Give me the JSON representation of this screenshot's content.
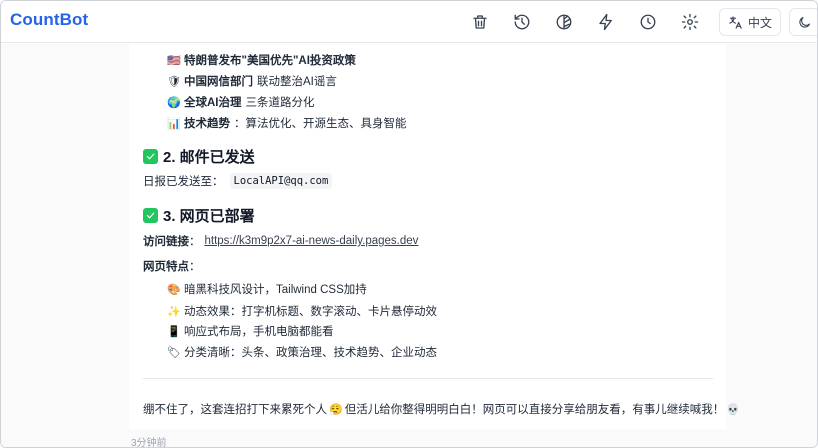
{
  "app": {
    "title": "CountBot"
  },
  "toolbar": {
    "items": [
      {
        "icon": "trash-icon"
      },
      {
        "icon": "history-icon"
      },
      {
        "icon": "contrast-icon"
      },
      {
        "icon": "lightning-icon"
      },
      {
        "icon": "clock-icon"
      },
      {
        "icon": "gear-icon"
      }
    ],
    "language_label": "中文"
  },
  "message": {
    "bullets_top": [
      {
        "emoji": "🇺🇸",
        "bold": "特朗普发布\"美国优先\"AI投资政策",
        "rest": ""
      },
      {
        "emoji": "🛡",
        "bold": "中国网信部门",
        "rest": "联动整治AI谣言"
      },
      {
        "emoji": "🌍",
        "bold": "全球AI治理",
        "rest": "三条道路分化"
      },
      {
        "emoji": "📊",
        "bold": "技术趋势",
        "rest": "：算法优化、开源生态、具身智能"
      }
    ],
    "section2": {
      "heading": "2. 邮件已发送",
      "sent_label": "日报已发送至：",
      "email": "LocalAPI@qq.com"
    },
    "section3": {
      "heading": "3. 网页已部署",
      "link_label": "访问链接",
      "link_colon": "：",
      "link_url": "https://k3m9p2x7-ai-news-daily.pages.dev",
      "features_label": "网页特点",
      "features_colon": "：",
      "features": [
        {
          "emoji": "🎨",
          "text": "暗黑科技风设计，Tailwind CSS加持"
        },
        {
          "emoji": "✨",
          "text": "动态效果：打字机标题、数字滚动、卡片悬停动效"
        },
        {
          "emoji": "📱",
          "text": "响应式布局，手机电脑都能看"
        },
        {
          "emoji": "🏷",
          "text": "分类清晰：头条、政策治理、技术趋势、企业动态"
        }
      ]
    },
    "closing_part1": "绷不住了，这套连招打下来累死个人",
    "closing_emoji": "😮‍💨",
    "closing_part2": " 但活儿给你整得明明白白！网页可以直接分享给朋友看，有事儿继续喊我！",
    "closing_emoji_end": "💀"
  },
  "timestamp": "3分钟前",
  "colors": {
    "brand": "#2563eb",
    "check": "#22c55e"
  }
}
